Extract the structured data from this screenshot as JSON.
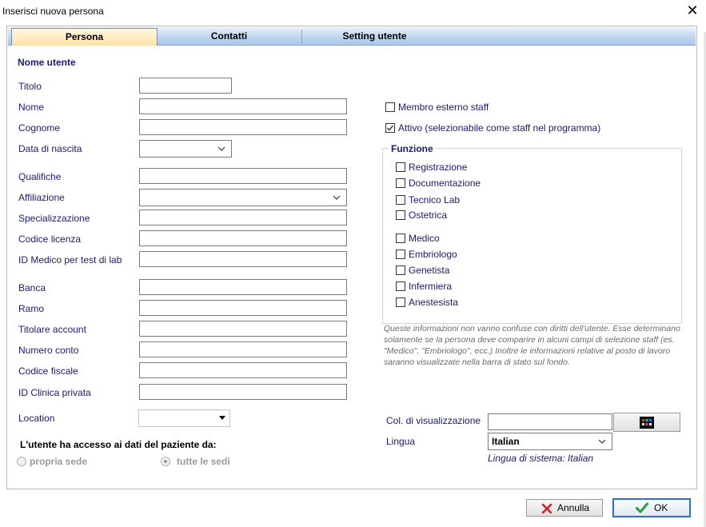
{
  "window": {
    "title": "Inserisci nuova persona"
  },
  "tabs": [
    "Persona",
    "Contatti",
    "Setting utente"
  ],
  "section_title": "Nome utente",
  "labels": {
    "titolo": "Titolo",
    "nome": "Nome",
    "cognome": "Cognome",
    "data_nascita": "Data di nascita",
    "qualifiche": "Qualifiche",
    "affiliazione": "Affiliazione",
    "specializzazione": "Specializzazione",
    "codice_licenza": "Codice licenza",
    "id_medico": "ID Medico per test di lab",
    "banca": "Banca",
    "ramo": "Ramo",
    "titolare": "Titolare account",
    "numero_conto": "Numero conto",
    "codice_fiscale": "Codice fiscale",
    "id_clinica": "ID Clinica privata",
    "location": "Location"
  },
  "access": {
    "title": "L'utente ha accesso ai dati del paziente da:",
    "option1": "propria sede",
    "option2": "tutte le sedi",
    "selected": "tutte le sedi"
  },
  "membro_esterno": {
    "label": "Membro esterno staff",
    "checked": false
  },
  "attivo": {
    "label": "Attivo (selezionabile come staff nel programma)",
    "checked": true
  },
  "funzione": {
    "title": "Funzione",
    "items": [
      "Registrazione",
      "Documentazione",
      "Tecnico Lab",
      "Ostetrica",
      "Medico",
      "Embriologo",
      "Genetista",
      "Infermiera",
      "Anestesista"
    ]
  },
  "note": "Queste informazioni non vanno confuse con diritti dell'utente. Esse determinano solamente se la persona deve comparire in alcuni campi di selezione staff (es. \"Medico\", \"Embriologo\", ecc.) Inoltre le informazioni relative al posto di lavoro saranno visualizzate nella barra di stato sul fondo.",
  "col_visualizzazione": "Col. di visualizzazione",
  "lingua": {
    "label": "Lingua",
    "value": "Italian",
    "sistema": "Lingua di sistema: Italian"
  },
  "buttons": {
    "annulla": "Annulla",
    "ok": "OK"
  }
}
